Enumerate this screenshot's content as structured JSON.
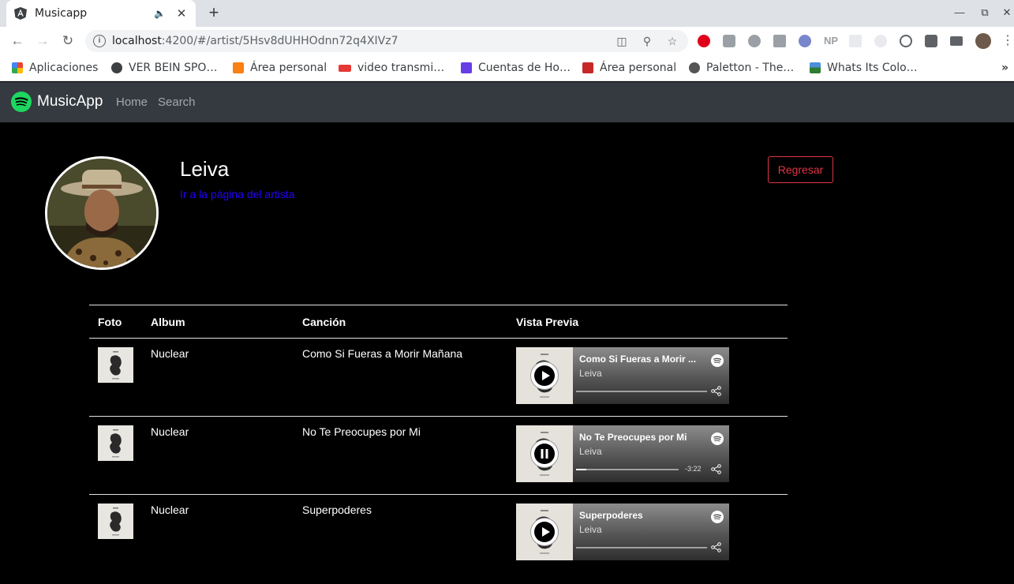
{
  "browser": {
    "tab_title": "Musicapp",
    "url_host": "localhost",
    "url_rest": ":4200/#/artist/5Hsv8dUHHOdnn72q4XIVz7",
    "bookmarks": [
      {
        "label": "Aplicaciones",
        "icon": "apps-grid-icon",
        "color": "#ea4335"
      },
      {
        "label": "VER BEIN SPO…",
        "icon": "globe-icon",
        "color": "#3c4043"
      },
      {
        "label": "Área personal",
        "icon": "moodle-icon",
        "color": "#f98012"
      },
      {
        "label": "video transmi…",
        "icon": "live-icon",
        "color": "#e53935"
      },
      {
        "label": "Cuentas de Ho…",
        "icon": "hostinger-icon",
        "color": "#673de6"
      },
      {
        "label": "Área personal",
        "icon": "shield-icon",
        "color": "#c62828"
      },
      {
        "label": "Paletton - The…",
        "icon": "paletton-icon",
        "color": "#555555"
      },
      {
        "label": "Whats Its Colo…",
        "icon": "landscape-icon",
        "color": "#2e7d32"
      }
    ],
    "more_bookmarks": "»"
  },
  "app": {
    "brand": "MusicApp",
    "nav": {
      "home": "Home",
      "search": "Search"
    },
    "brand_color": "#1ed760"
  },
  "artist": {
    "name": "Leiva",
    "link_text": "Ir a la página del artista",
    "back_button": "Regresar"
  },
  "table": {
    "headers": {
      "foto": "Foto",
      "album": "Album",
      "cancion": "Canción",
      "preview": "Vista Previa"
    },
    "rows": [
      {
        "album": "Nuclear",
        "song": "Como Si Fueras a Morir Mañana",
        "preview_title": "Como Si Fueras a Morir ...",
        "preview_artist": "Leiva",
        "state": "paused",
        "progress": 0,
        "time": ""
      },
      {
        "album": "Nuclear",
        "song": "No Te Preocupes por Mi",
        "preview_title": "No Te Preocupes por Mi",
        "preview_artist": "Leiva",
        "state": "playing",
        "progress": 0.1,
        "time": "-3:22"
      },
      {
        "album": "Nuclear",
        "song": "Superpoderes",
        "preview_title": "Superpoderes",
        "preview_artist": "Leiva",
        "state": "paused",
        "progress": 0,
        "time": ""
      }
    ]
  }
}
